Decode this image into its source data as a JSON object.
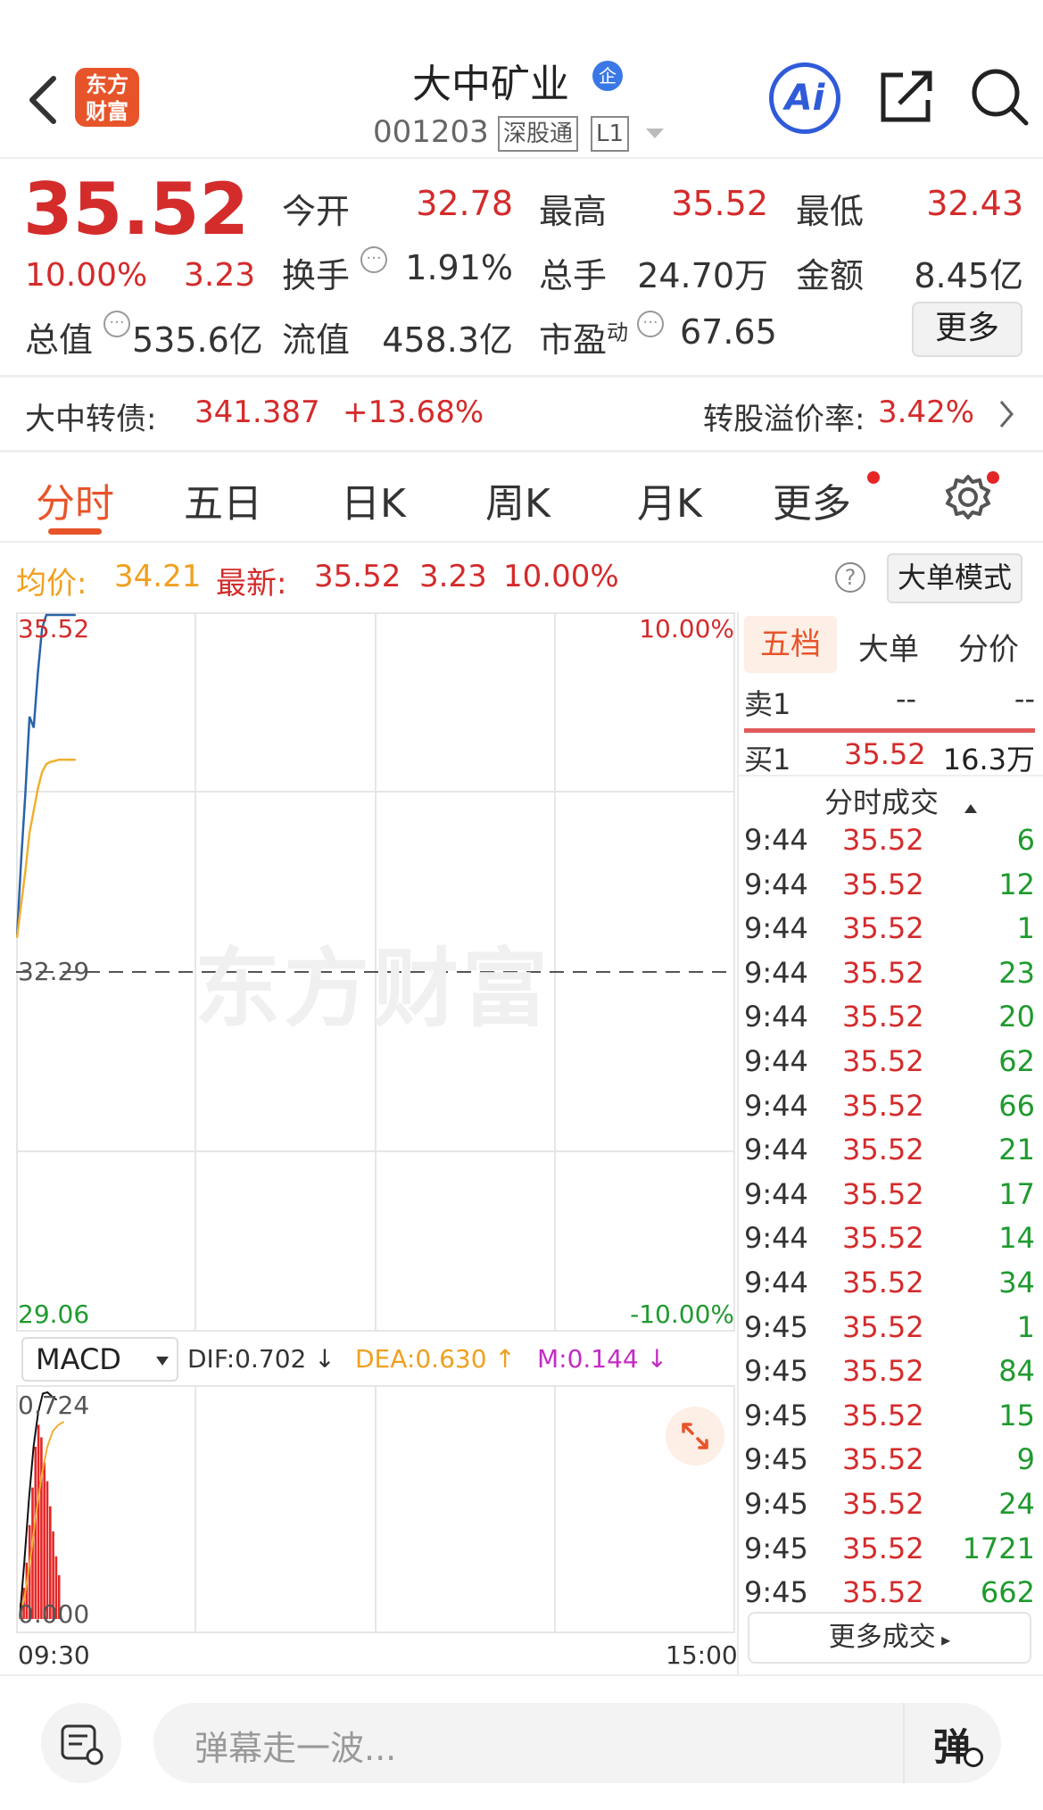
{
  "header": {
    "brand_logo": "东方\n财富",
    "stock_name": "大中矿业",
    "stock_code": "001203",
    "board_tag": "深股通",
    "level_tag": "L1",
    "ai_label": "Ai",
    "enterprise_tag": "企"
  },
  "quote": {
    "price": "35.52",
    "change_pct": "10.00%",
    "change": "3.23",
    "fields": [
      {
        "label": "今开",
        "value": "32.78",
        "color": "red"
      },
      {
        "label": "最高",
        "value": "35.52",
        "color": "red"
      },
      {
        "label": "最低",
        "value": "32.43",
        "color": "red"
      },
      {
        "label": "换手",
        "value": "1.91%",
        "color": "dark"
      },
      {
        "label": "总手",
        "value": "24.70万",
        "color": "dark"
      },
      {
        "label": "金额",
        "value": "8.45亿",
        "color": "dark"
      },
      {
        "label": "总值",
        "value": "535.6亿",
        "color": "dark"
      },
      {
        "label": "流值",
        "value": "458.3亿",
        "color": "dark"
      },
      {
        "label": "市盈",
        "label_sup": "动",
        "value": "67.65",
        "color": "dark"
      }
    ],
    "more_button": "更多"
  },
  "bond": {
    "label": "大中转债:",
    "price": "341.387",
    "change": "+13.68%",
    "premium_label": "转股溢价率:",
    "premium_value": "3.42%"
  },
  "tabs": [
    "分时",
    "五日",
    "日K",
    "周K",
    "月K",
    "更多"
  ],
  "info_bar": {
    "avg_label": "均价:",
    "avg_value": "34.21",
    "last_label": "最新:",
    "last_value": "35.52",
    "change": "3.23",
    "change_pct": "10.00%",
    "big_order_button": "大单模式"
  },
  "chart": {
    "top_price": "35.52",
    "top_pct": "10.00%",
    "mid_price": "32.29",
    "bottom_price": "29.06",
    "bottom_pct": "-10.00%",
    "watermark": "东方财富",
    "time_start": "09:30",
    "time_end": "15:00",
    "colors": {
      "price": "#2b63a8",
      "avg": "#f0b030",
      "up": "#e52626"
    }
  },
  "chart_data": {
    "type": "line",
    "series": [
      {
        "values": [
          32.6,
          33.3,
          33.9,
          34.6,
          34.5,
          35.0,
          35.4,
          35.52,
          35.52,
          35.52,
          35.52,
          35.52,
          35.52,
          35.52,
          35.52
        ]
      },
      {
        "values": [
          32.6,
          32.9,
          33.2,
          33.55,
          33.75,
          33.95,
          34.1,
          34.17,
          34.19,
          34.2,
          34.21,
          34.21,
          34.21,
          34.21,
          34.21
        ]
      }
    ],
    "ylim": [
      29.06,
      35.52
    ],
    "y_ticks_left": [
      "35.52",
      "32.29",
      "29.06"
    ],
    "y_ticks_right": [
      "10.00%",
      "-10.00%"
    ],
    "x_ticks": [
      "09:30",
      "15:00"
    ],
    "grid": true
  },
  "macd": {
    "selector": "MACD",
    "dif": "DIF:0.702 ↓",
    "dea": "DEA:0.630 ↑",
    "m": "M:0.144 ↓",
    "top": "0.724",
    "zero": "0.000",
    "bars": [
      0.05,
      0.1,
      0.18,
      0.3,
      0.42,
      0.55,
      0.62,
      0.58,
      0.5,
      0.44,
      0.36,
      0.28,
      0.2,
      0.14
    ]
  },
  "order_book": {
    "tabs": [
      "五档",
      "大单",
      "分价"
    ],
    "sell1_label": "卖1",
    "sell1_price": "--",
    "sell1_vol": "--",
    "buy1_label": "买1",
    "buy1_price": "35.52",
    "buy1_vol": "16.3万",
    "trades_title": "分时成交",
    "more_trades": "更多成交"
  },
  "trades": [
    {
      "time": "9:44",
      "price": "35.52",
      "vol": "6"
    },
    {
      "time": "9:44",
      "price": "35.52",
      "vol": "12"
    },
    {
      "time": "9:44",
      "price": "35.52",
      "vol": "1"
    },
    {
      "time": "9:44",
      "price": "35.52",
      "vol": "23"
    },
    {
      "time": "9:44",
      "price": "35.52",
      "vol": "20"
    },
    {
      "time": "9:44",
      "price": "35.52",
      "vol": "62"
    },
    {
      "time": "9:44",
      "price": "35.52",
      "vol": "66"
    },
    {
      "time": "9:44",
      "price": "35.52",
      "vol": "21"
    },
    {
      "time": "9:44",
      "price": "35.52",
      "vol": "17"
    },
    {
      "time": "9:44",
      "price": "35.52",
      "vol": "14"
    },
    {
      "time": "9:44",
      "price": "35.52",
      "vol": "34"
    },
    {
      "time": "9:45",
      "price": "35.52",
      "vol": "1"
    },
    {
      "time": "9:45",
      "price": "35.52",
      "vol": "84"
    },
    {
      "time": "9:45",
      "price": "35.52",
      "vol": "15"
    },
    {
      "time": "9:45",
      "price": "35.52",
      "vol": "9"
    },
    {
      "time": "9:45",
      "price": "35.52",
      "vol": "24"
    },
    {
      "time": "9:45",
      "price": "35.52",
      "vol": "1721"
    },
    {
      "time": "9:45",
      "price": "35.52",
      "vol": "662"
    }
  ],
  "bottom": {
    "danmaku_placeholder": "弹幕走一波...",
    "danmaku_button": "弹"
  }
}
